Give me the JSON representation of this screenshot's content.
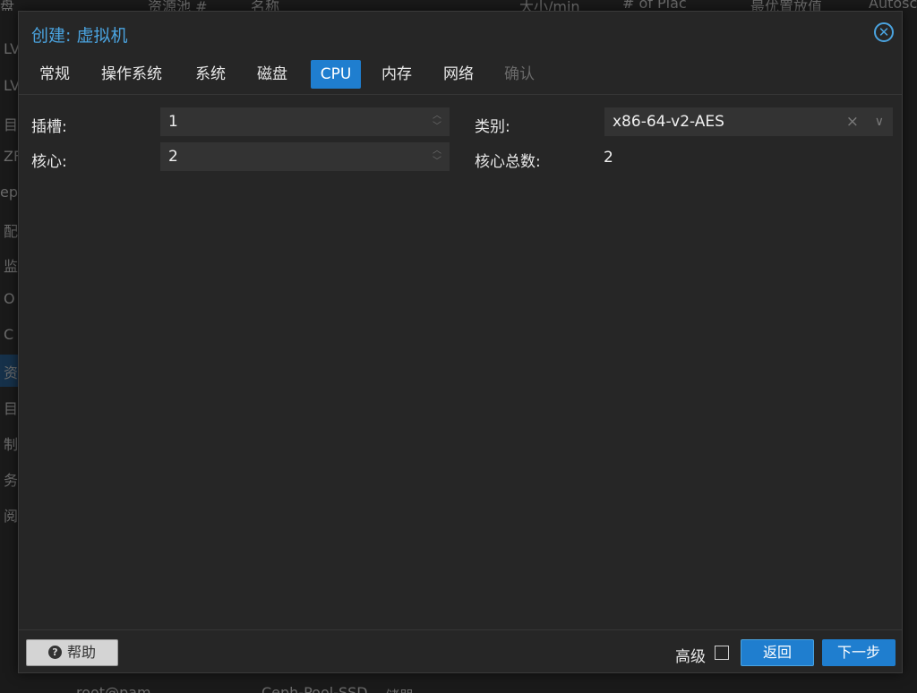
{
  "background": {
    "header_columns": [
      "盘",
      "资源池 #",
      "名称",
      "大小/min",
      "# of Plac",
      "最优置放值",
      "Autosc"
    ],
    "left_items": [
      "LV",
      "LV",
      "目",
      "ZF",
      "eph",
      "配",
      "监",
      "O",
      "C",
      "资",
      "目",
      "制",
      "务",
      "阅"
    ],
    "bottom_texts": [
      "root@pam",
      "Ceph-Pool-SSD",
      "储器"
    ]
  },
  "dialog": {
    "title": "创建: 虚拟机",
    "close_icon": "close-circle-icon",
    "tabs": [
      {
        "label": "常规",
        "state": "normal"
      },
      {
        "label": "操作系统",
        "state": "normal"
      },
      {
        "label": "系统",
        "state": "normal"
      },
      {
        "label": "磁盘",
        "state": "normal"
      },
      {
        "label": "CPU",
        "state": "active"
      },
      {
        "label": "内存",
        "state": "normal"
      },
      {
        "label": "网络",
        "state": "normal"
      },
      {
        "label": "确认",
        "state": "disabled"
      }
    ],
    "form": {
      "sockets_label": "插槽:",
      "sockets_value": "1",
      "cores_label": "核心:",
      "cores_value": "2",
      "type_label": "类别:",
      "type_value": "x86-64-v2-AES",
      "clear_glyph": "×",
      "dropdown_glyph": "∨",
      "total_cores_label": "核心总数:",
      "total_cores_value": "2"
    },
    "footer": {
      "help_label": "帮助",
      "advanced_label": "高级",
      "advanced_checked": false,
      "back_label": "返回",
      "next_label": "下一步"
    }
  },
  "colors": {
    "accent": "#1f7ecf",
    "title": "#4aa3df",
    "dialog_bg": "#262626",
    "field_bg": "#333333"
  }
}
